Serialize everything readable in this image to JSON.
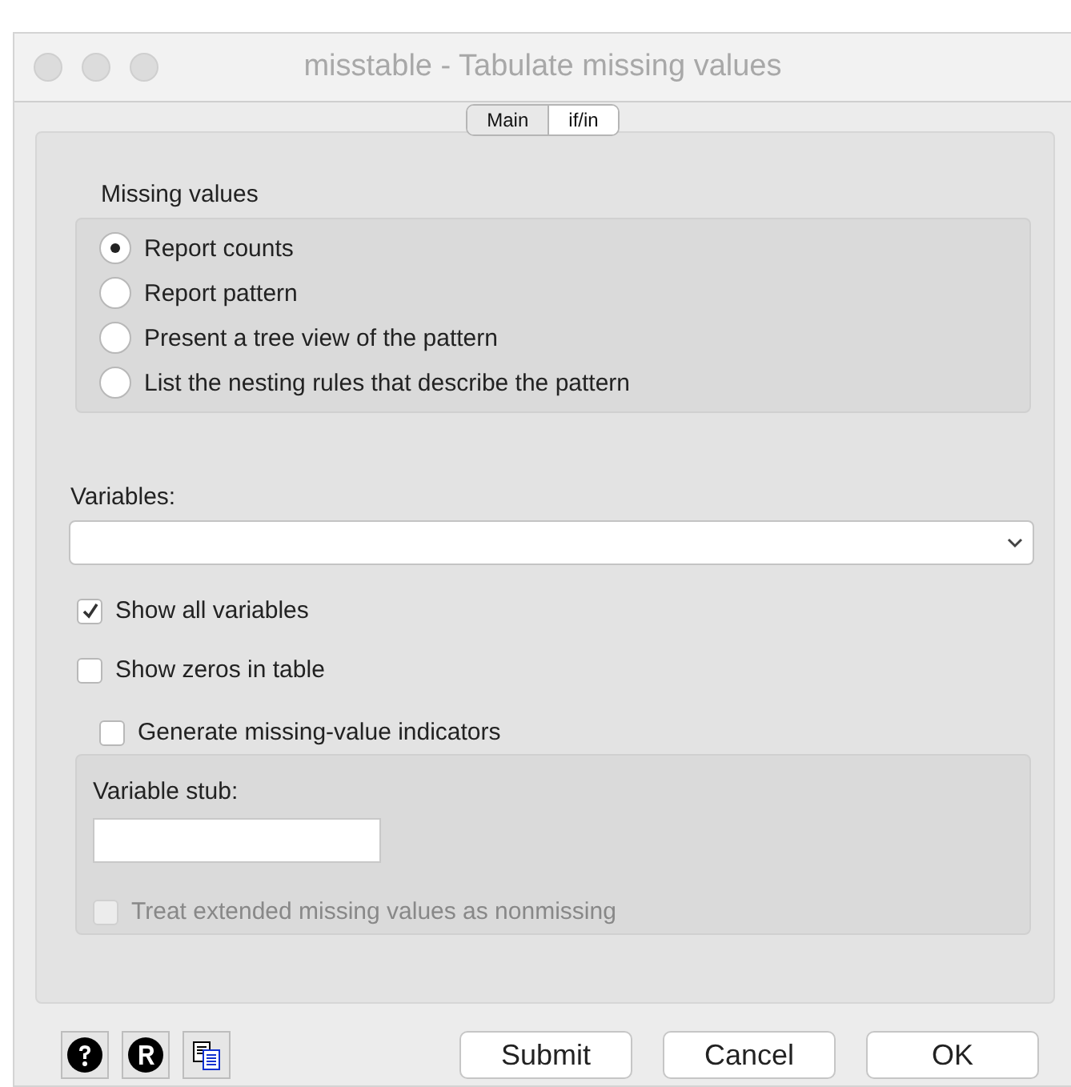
{
  "window": {
    "title": "misstable - Tabulate missing values"
  },
  "tabs": [
    {
      "label": "Main",
      "selected": true
    },
    {
      "label": "if/in",
      "selected": false
    }
  ],
  "missing_values": {
    "title": "Missing values",
    "options": [
      {
        "label": "Report counts",
        "selected": true
      },
      {
        "label": "Report pattern",
        "selected": false
      },
      {
        "label": "Present a tree view of the pattern",
        "selected": false
      },
      {
        "label": "List the nesting rules that describe the pattern",
        "selected": false
      }
    ]
  },
  "variables": {
    "label": "Variables:"
  },
  "checks": [
    {
      "label": "Show all variables",
      "checked": true
    },
    {
      "label": "Show zeros in table",
      "checked": false
    }
  ],
  "indicators": {
    "label": "Generate missing-value indicators",
    "checked": false,
    "stub_label": "Variable stub:",
    "extended": {
      "label": "Treat extended missing values as nonmissing",
      "checked": false,
      "disabled": true
    }
  },
  "buttons": [
    "Submit",
    "Cancel",
    "OK"
  ]
}
